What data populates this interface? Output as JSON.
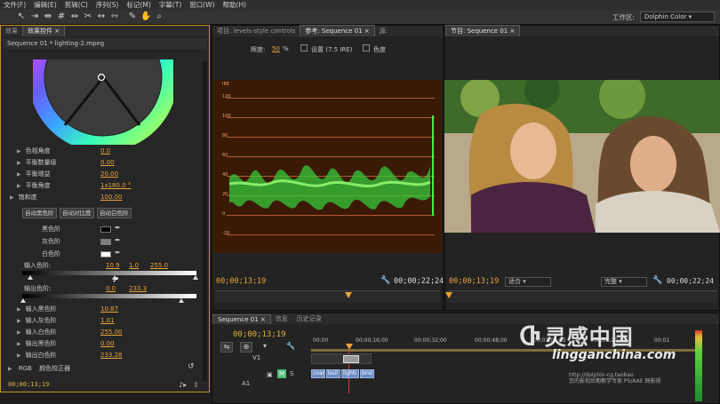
{
  "menu": [
    "文件(F)",
    "编辑(E)",
    "剪辑(C)",
    "序列(S)",
    "标记(M)",
    "字幕(T)",
    "窗口(W)",
    "帮助(H)"
  ],
  "workspace": {
    "label": "工作区:",
    "value": "Dolphin Color"
  },
  "fx_panel": {
    "tabs": [
      "效果",
      "效果控件 ×"
    ],
    "header": "Sequence 01 * lighting-2.mpeg",
    "props": [
      {
        "label": "色相角度",
        "value": "0.0"
      },
      {
        "label": "平衡数量级",
        "value": "0.00"
      },
      {
        "label": "平衡增益",
        "value": "20.00"
      },
      {
        "label": "平衡角度",
        "value": "1x180.0 °"
      },
      {
        "label": "饱和度",
        "value": "100.00"
      }
    ],
    "buttons": [
      "自动黑色阶",
      "自动对比度",
      "自动白色阶"
    ],
    "black_level": "黑色阶",
    "gray_level": "灰色阶",
    "white_level": "白色阶",
    "input_levels": {
      "label": "输入色阶:",
      "v1": "10.9",
      "v2": "1.0",
      "v3": "255.0"
    },
    "output_levels": {
      "label": "输出色阶:",
      "v1": "0.0",
      "v2": "233.3"
    },
    "level_props": [
      {
        "label": "输入黑色阶",
        "value": "10.87"
      },
      {
        "label": "输入灰色阶",
        "value": "1.01"
      },
      {
        "label": "输入白色阶",
        "value": "255.00"
      },
      {
        "label": "输出黑色阶",
        "value": "0.00"
      },
      {
        "label": "输出白色阶",
        "value": "233.26"
      }
    ],
    "rgb_label": "RGB",
    "corrector_label": "颜色校正器",
    "timecode": "00;00;13;19"
  },
  "scope_panel": {
    "tabs": [
      "项目: levels-style controls",
      "参考: Sequence 01 ×",
      "源: "
    ],
    "brightness_label": "辉度:",
    "brightness_value": "50",
    "brightness_unit": "%",
    "setup_label": "设置 (7.5 IRE)",
    "chroma_label": "色度",
    "scale_labels": [
      "IRE",
      "120",
      "100",
      "80",
      "60",
      "40",
      "20",
      "0",
      "-20"
    ],
    "timecode_left": "00;00;13;19",
    "timecode_right": "00;00;22;24"
  },
  "program_panel": {
    "tab": "节目: Sequence 01 ×",
    "timecode_left": "00;00;13;19",
    "fit_label": "适合",
    "quality_label": "完整",
    "timecode_right": "00;00;22;24"
  },
  "timeline": {
    "tabs": [
      "Sequence 01 ×",
      "信息",
      "历史记录"
    ],
    "timecode": "00;00;13;19",
    "ruler": [
      "00;00",
      "00;00;16;00",
      "00;00;32;00",
      "00;00;48;00",
      "00;01;04;02",
      "00;01;20;02",
      "00;01"
    ],
    "tracks": [
      "V1",
      "A1"
    ],
    "track_toggles": [
      "M",
      "S"
    ],
    "clips": [
      "coar",
      "buil",
      "lighti",
      "brid"
    ]
  },
  "watermark": {
    "logo": "灵感中国",
    "url": "lingganchina.com",
    "sub1": "http://dolphin-cg.taobao",
    "sub2": "您的影视后期教学专家 PS/AAE 网影视"
  },
  "colors": {
    "accent": "#e8a33a",
    "panel": "#232323",
    "highlight": "#c39128"
  }
}
